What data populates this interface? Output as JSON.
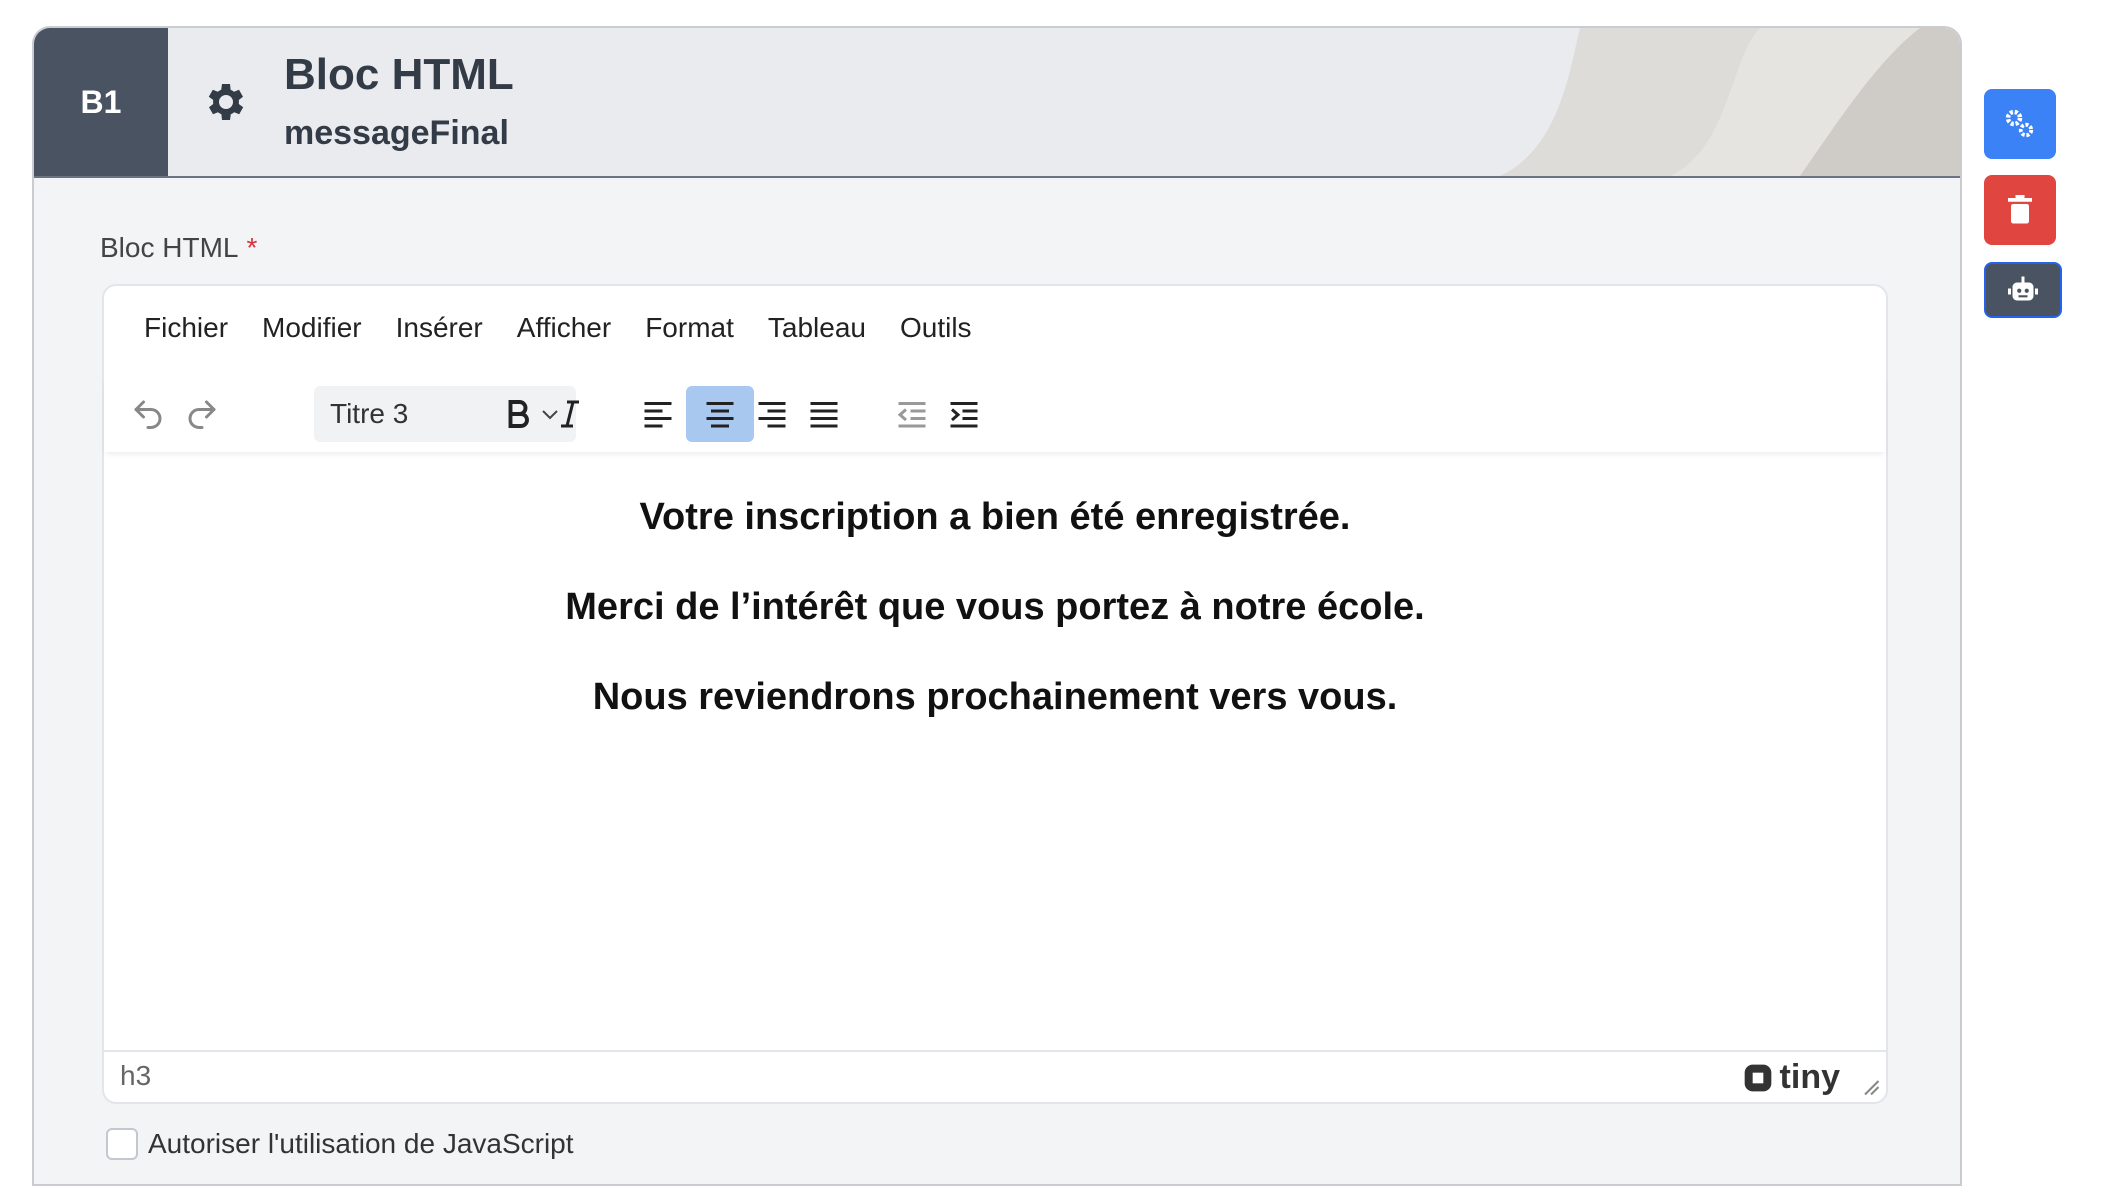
{
  "header": {
    "badge": "B1",
    "title": "Bloc HTML",
    "subtitle": "messageFinal"
  },
  "field": {
    "label": "Bloc HTML",
    "required_mark": "*"
  },
  "editor": {
    "menu": [
      "Fichier",
      "Modifier",
      "Insérer",
      "Afficher",
      "Format",
      "Tableau",
      "Outils"
    ],
    "block_format": "Titre 3",
    "content": [
      "Votre inscription a bien été enregistrée.",
      "Merci de l’intérêt que vous portez à notre école.",
      "Nous reviendrons prochainement vers vous."
    ],
    "status_path": "h3",
    "brand": "tiny",
    "active_alignment": "center"
  },
  "options": {
    "js_label": "Autoriser l'utilisation de JavaScript",
    "js_checked": false
  },
  "colors": {
    "settings_button": "#3b82f6",
    "delete_button": "#e0453f",
    "robot_button": "#4a5362",
    "header_badge": "#4a5362",
    "active_toolbar": "#a8c8f0"
  },
  "icons": {
    "settings": "gears-icon",
    "delete": "trash-icon",
    "robot": "robot-icon",
    "header": "gear-icon"
  }
}
